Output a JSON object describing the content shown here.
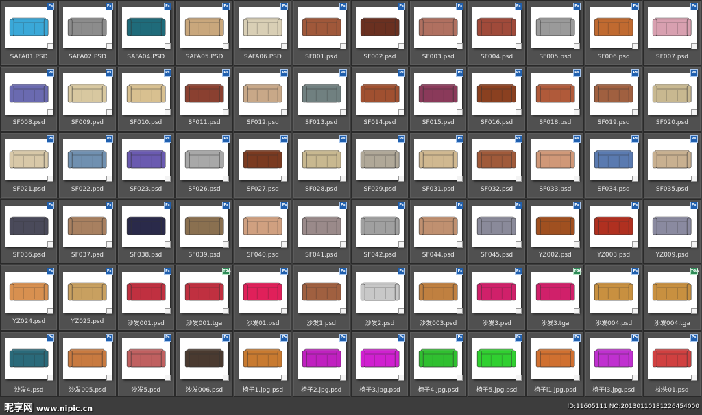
{
  "gallery": {
    "items": [
      {
        "label": "SAFA01.PSD",
        "badge": "Ps",
        "color": "#3aa8d8"
      },
      {
        "label": "SAFA02.PSD",
        "badge": "Ps",
        "color": "#8c8c8c"
      },
      {
        "label": "SAFA04.PSD",
        "badge": "Ps",
        "color": "#1f6b7a"
      },
      {
        "label": "SAFA05.PSD",
        "badge": "Ps",
        "color": "#c9a77c"
      },
      {
        "label": "SAFA06.PSD",
        "badge": "Ps",
        "color": "#d9cfb5"
      },
      {
        "label": "SF001.psd",
        "badge": "Ps",
        "color": "#a0583a"
      },
      {
        "label": "SF002.psd",
        "badge": "Ps",
        "color": "#6a3020"
      },
      {
        "label": "SF003.psd",
        "badge": "Ps",
        "color": "#b07060"
      },
      {
        "label": "SF004.psd",
        "badge": "Ps",
        "color": "#a04a3a"
      },
      {
        "label": "SF005.psd",
        "badge": "Ps",
        "color": "#9a9a9a"
      },
      {
        "label": "SF006.psd",
        "badge": "Ps",
        "color": "#c06a30"
      },
      {
        "label": "SF007.psd",
        "badge": "Ps",
        "color": "#d8a0b0"
      },
      {
        "label": "SF008.psd",
        "badge": "Ps",
        "color": "#6a6ab0"
      },
      {
        "label": "SF009.psd",
        "badge": "Ps",
        "color": "#d8c8a0"
      },
      {
        "label": "SF010.psd",
        "badge": "Ps",
        "color": "#d8c090"
      },
      {
        "label": "SF011.psd",
        "badge": "Ps",
        "color": "#8a4030"
      },
      {
        "label": "SF012.psd",
        "badge": "Ps",
        "color": "#c8a888"
      },
      {
        "label": "SF013.psd",
        "badge": "Ps",
        "color": "#708080"
      },
      {
        "label": "SF014.psd",
        "badge": "Ps",
        "color": "#a05030"
      },
      {
        "label": "SF015.psd",
        "badge": "Ps",
        "color": "#8a3a5a"
      },
      {
        "label": "SF016.psd",
        "badge": "Ps",
        "color": "#8a4020"
      },
      {
        "label": "SF018.psd",
        "badge": "Ps",
        "color": "#b05a3a"
      },
      {
        "label": "SF019.psd",
        "badge": "Ps",
        "color": "#a06040"
      },
      {
        "label": "SF020.psd",
        "badge": "Ps",
        "color": "#c8b890"
      },
      {
        "label": "SF021.psd",
        "badge": "Ps",
        "color": "#d8c8a8"
      },
      {
        "label": "SF022.psd",
        "badge": "Ps",
        "color": "#7090b0"
      },
      {
        "label": "SF023.psd",
        "badge": "Ps",
        "color": "#6a5ab0"
      },
      {
        "label": "SF026.psd",
        "badge": "Ps",
        "color": "#a8a8a8"
      },
      {
        "label": "SF027.psd",
        "badge": "Ps",
        "color": "#7a3a20"
      },
      {
        "label": "SF028.psd",
        "badge": "Ps",
        "color": "#c8b890"
      },
      {
        "label": "SF029.psd",
        "badge": "Ps",
        "color": "#b0a898"
      },
      {
        "label": "SF031.psd",
        "badge": "Ps",
        "color": "#d0b890"
      },
      {
        "label": "SF032.psd",
        "badge": "Ps",
        "color": "#a05a3a"
      },
      {
        "label": "SF033.psd",
        "badge": "Ps",
        "color": "#d09878"
      },
      {
        "label": "SF034.psd",
        "badge": "Ps",
        "color": "#5a7ab0"
      },
      {
        "label": "SF035.psd",
        "badge": "Ps",
        "color": "#c8b090"
      },
      {
        "label": "SF036.psd",
        "badge": "Ps",
        "color": "#4a4a5a"
      },
      {
        "label": "SF037.psd",
        "badge": "Ps",
        "color": "#a88060"
      },
      {
        "label": "SF038.psd",
        "badge": "Ps",
        "color": "#2a2a4a"
      },
      {
        "label": "SF039.psd",
        "badge": "Ps",
        "color": "#8a7050"
      },
      {
        "label": "SF040.psd",
        "badge": "Ps",
        "color": "#d0a080"
      },
      {
        "label": "SF041.psd",
        "badge": "Ps",
        "color": "#9a8a8a"
      },
      {
        "label": "SF042.psd",
        "badge": "Ps",
        "color": "#a0a0a0"
      },
      {
        "label": "SF044.psd",
        "badge": "Ps",
        "color": "#c09070"
      },
      {
        "label": "SF045.psd",
        "badge": "Ps",
        "color": "#8a8a9a"
      },
      {
        "label": "YZ002.psd",
        "badge": "Ps",
        "color": "#a05020"
      },
      {
        "label": "YZ003.psd",
        "badge": "Ps",
        "color": "#b03020"
      },
      {
        "label": "YZ009.psd",
        "badge": "Ps",
        "color": "#8a8aa0"
      },
      {
        "label": "YZ024.psd",
        "badge": "Ps",
        "color": "#d89050"
      },
      {
        "label": "YZ025.psd",
        "badge": "Ps",
        "color": "#c8a060"
      },
      {
        "label": "沙发001.psd",
        "badge": "Ps",
        "color": "#c03040"
      },
      {
        "label": "沙发001.tga",
        "badge": "TGA",
        "color": "#c03040"
      },
      {
        "label": "沙发01.psd",
        "badge": "Ps",
        "color": "#e0205a"
      },
      {
        "label": "沙发1.psd",
        "badge": "Ps",
        "color": "#a06040"
      },
      {
        "label": "沙发2.psd",
        "badge": "Ps",
        "color": "#c8c8c8"
      },
      {
        "label": "沙发003.psd",
        "badge": "Ps",
        "color": "#c08040"
      },
      {
        "label": "沙发3.psd",
        "badge": "Ps",
        "color": "#d0206a"
      },
      {
        "label": "沙发3.tga",
        "badge": "TGA",
        "color": "#d0206a"
      },
      {
        "label": "沙发004.psd",
        "badge": "Ps",
        "color": "#c89040"
      },
      {
        "label": "沙发004.tga",
        "badge": "TGA",
        "color": "#c89040"
      },
      {
        "label": "沙发4.psd",
        "badge": "Ps",
        "color": "#2a6a7a"
      },
      {
        "label": "沙发005.psd",
        "badge": "Ps",
        "color": "#c87a40"
      },
      {
        "label": "沙发5.psd",
        "badge": "Ps",
        "color": "#c06060"
      },
      {
        "label": "沙发006.psd",
        "badge": "Ps",
        "color": "#4a3a30"
      },
      {
        "label": "椅子1.jpg.psd",
        "badge": "Ps",
        "color": "#c87a30"
      },
      {
        "label": "椅子2.jpg.psd",
        "badge": "Ps",
        "color": "#c020c0"
      },
      {
        "label": "椅子3.jpg.psd",
        "badge": "Ps",
        "color": "#d020d0"
      },
      {
        "label": "椅子4.jpg.psd",
        "badge": "Ps",
        "color": "#30c030"
      },
      {
        "label": "椅子5.jpg.psd",
        "badge": "Ps",
        "color": "#30d030"
      },
      {
        "label": "椅子l1.jpg.psd",
        "badge": "Ps",
        "color": "#d07030"
      },
      {
        "label": "椅子l3.jpg.psd",
        "badge": "Ps",
        "color": "#c030d0"
      },
      {
        "label": "枕头01.psd",
        "badge": "Ps",
        "color": "#d04040"
      }
    ]
  },
  "watermark": {
    "logo": "昵享网",
    "site": "www.nipic.cn",
    "id_text": "ID:11605111 NO:20130110181226454000"
  }
}
